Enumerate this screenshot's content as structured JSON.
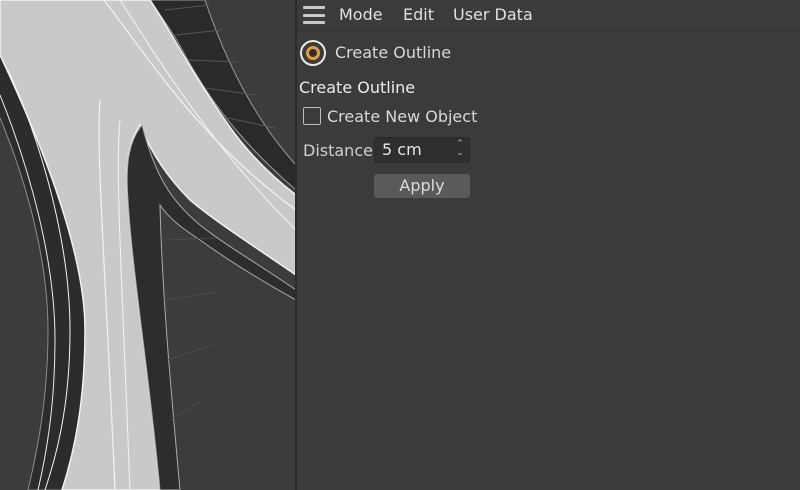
{
  "menubar": {
    "items": [
      "Mode",
      "Edit",
      "User Data"
    ]
  },
  "tool": {
    "icon": "create-outline-tool-icon",
    "title": "Create Outline",
    "accent": "#e89a3c"
  },
  "section": {
    "title": "Create Outline"
  },
  "options": {
    "create_new_object": {
      "label": "Create New Object",
      "checked": false
    },
    "distance": {
      "label": "Distance",
      "value": "5 cm"
    }
  },
  "apply_label": "Apply"
}
